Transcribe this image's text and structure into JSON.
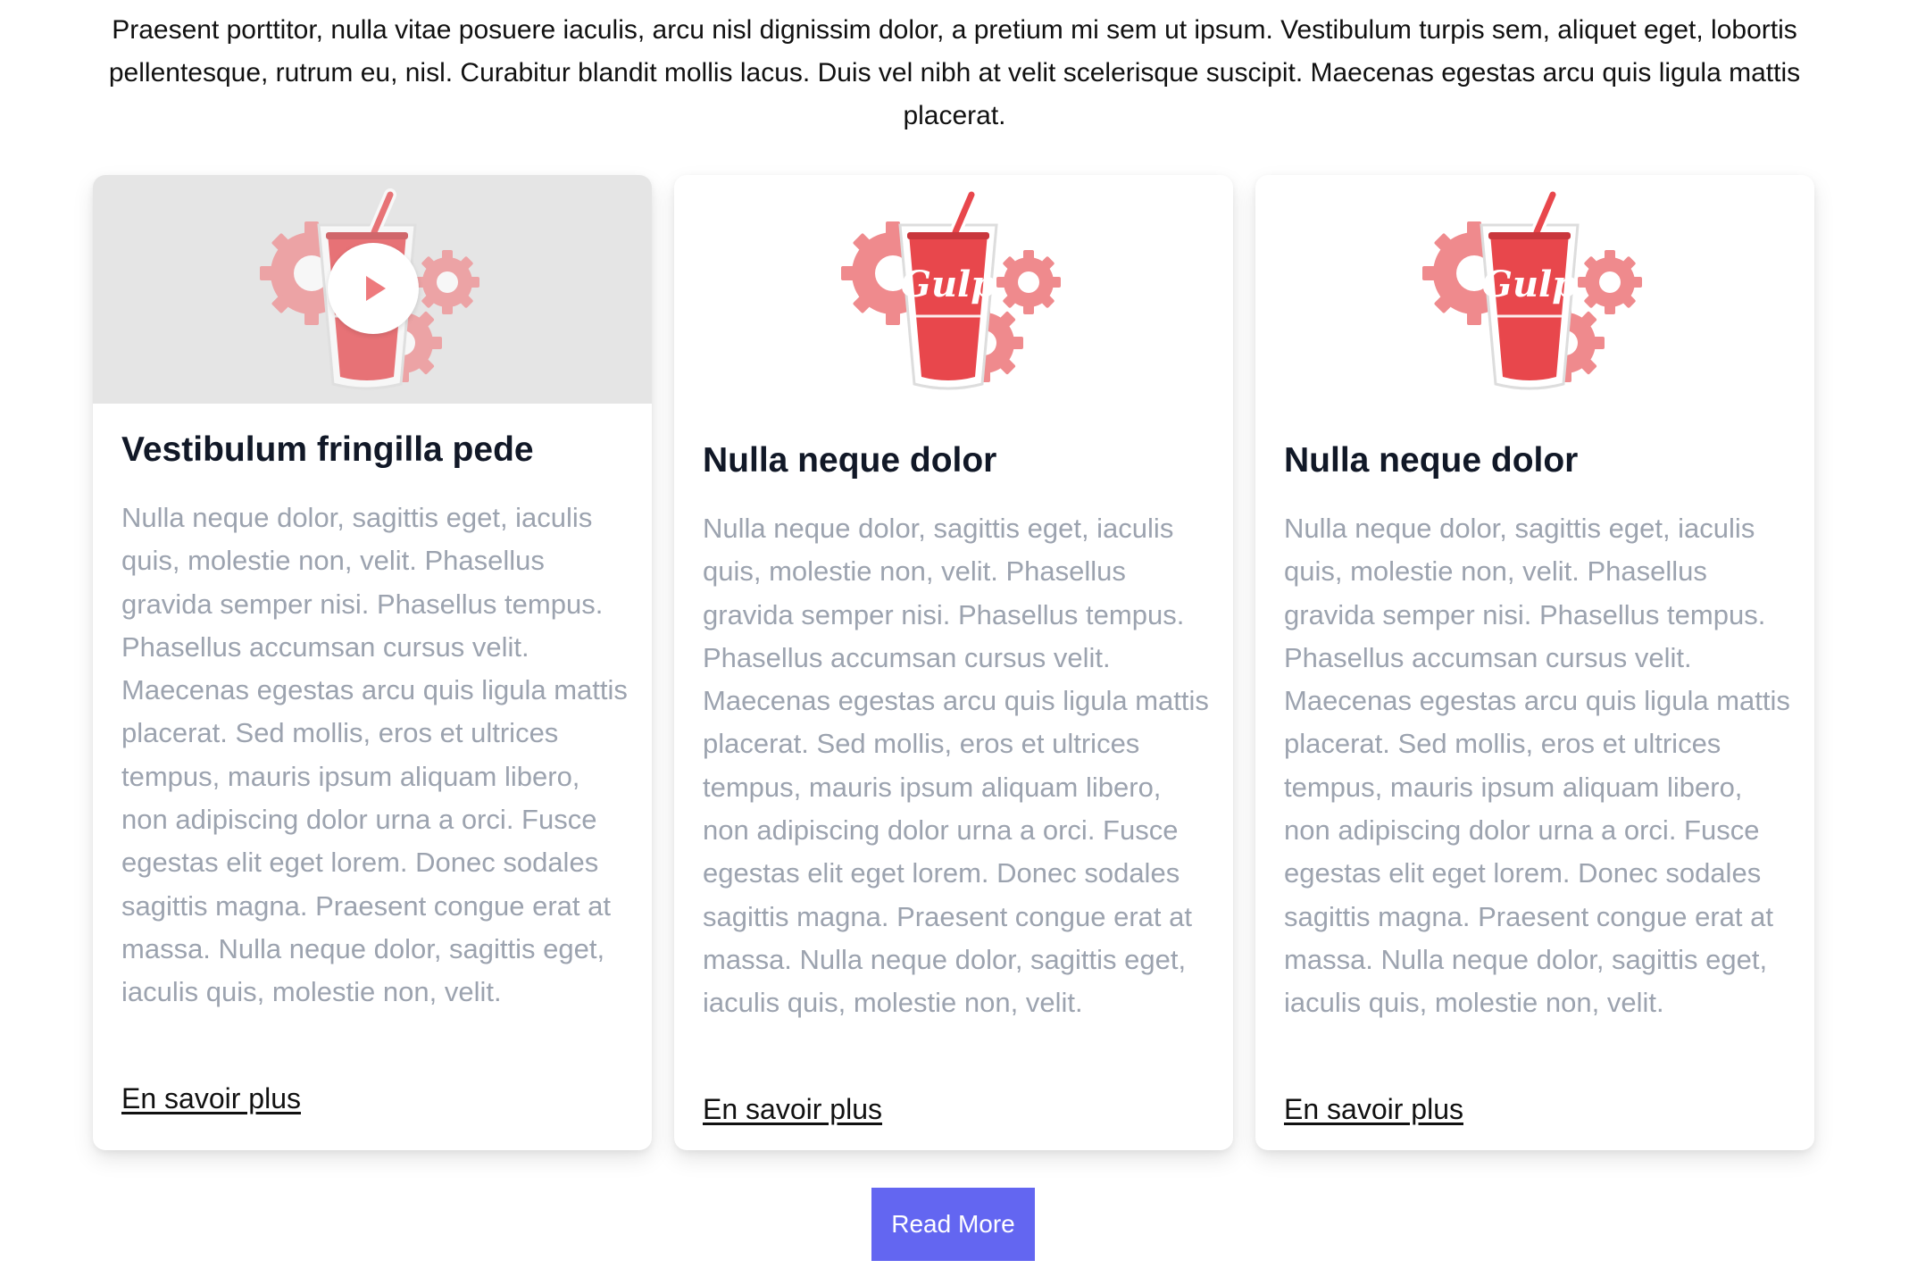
{
  "intro": "Praesent porttitor, nulla vitae posuere iaculis, arcu nisl dignissim dolor, a pretium mi sem ut ipsum. Vestibulum turpis sem, aliquet eget, lobortis pellentesque, rutrum eu, nisl. Curabitur blandit mollis lacus. Duis vel nibh at velit scelerisque suscipit. Maecenas egestas arcu quis ligula mattis placerat.",
  "cards": [
    {
      "image_icon": "gulp-logo",
      "has_video": true,
      "title": "Vestibulum fringilla pede",
      "body": "Nulla neque dolor, sagittis eget, iaculis quis, molestie non, velit. Phasellus gravida semper nisi. Phasellus tempus. Phasellus accumsan cursus velit. Maecenas egestas arcu quis ligula mattis placerat. Sed mollis, eros et ultrices tempus, mauris ipsum aliquam libero, non adipiscing dolor urna a orci. Fusce egestas elit eget lorem. Donec sodales sagittis magna. Praesent congue erat at massa. Nulla neque dolor, sagittis eget, iaculis quis, molestie non, velit.",
      "link": "En savoir plus"
    },
    {
      "image_icon": "gulp-logo",
      "logo_text": "Gulp",
      "title": "Nulla neque dolor",
      "body": "Nulla neque dolor, sagittis eget, iaculis quis, molestie non, velit. Phasellus gravida semper nisi. Phasellus tempus. Phasellus accumsan cursus velit. Maecenas egestas arcu quis ligula mattis placerat. Sed mollis, eros et ultrices tempus, mauris ipsum aliquam libero, non adipiscing dolor urna a orci. Fusce egestas elit eget lorem. Donec sodales sagittis magna. Praesent congue erat at massa. Nulla neque dolor, sagittis eget, iaculis quis, molestie non, velit.",
      "link": "En savoir plus"
    },
    {
      "image_icon": "gulp-logo",
      "logo_text": "Gulp",
      "title": "Nulla neque dolor",
      "body": "Nulla neque dolor, sagittis eget, iaculis quis, molestie non, velit. Phasellus gravida semper nisi. Phasellus tempus. Phasellus accumsan cursus velit. Maecenas egestas arcu quis ligula mattis placerat. Sed mollis, eros et ultrices tempus, mauris ipsum aliquam libero, non adipiscing dolor urna a orci. Fusce egestas elit eget lorem. Donec sodales sagittis magna. Praesent congue erat at massa. Nulla neque dolor, sagittis eget, iaculis quis, molestie non, velit.",
      "link": "En savoir plus"
    }
  ],
  "read_more": "Read More",
  "colors": {
    "accent": "#6366f1",
    "gulp_red": "#e8474c",
    "gear_pink": "#ef8a8d",
    "title": "#111827",
    "muted": "#9ca3af"
  }
}
